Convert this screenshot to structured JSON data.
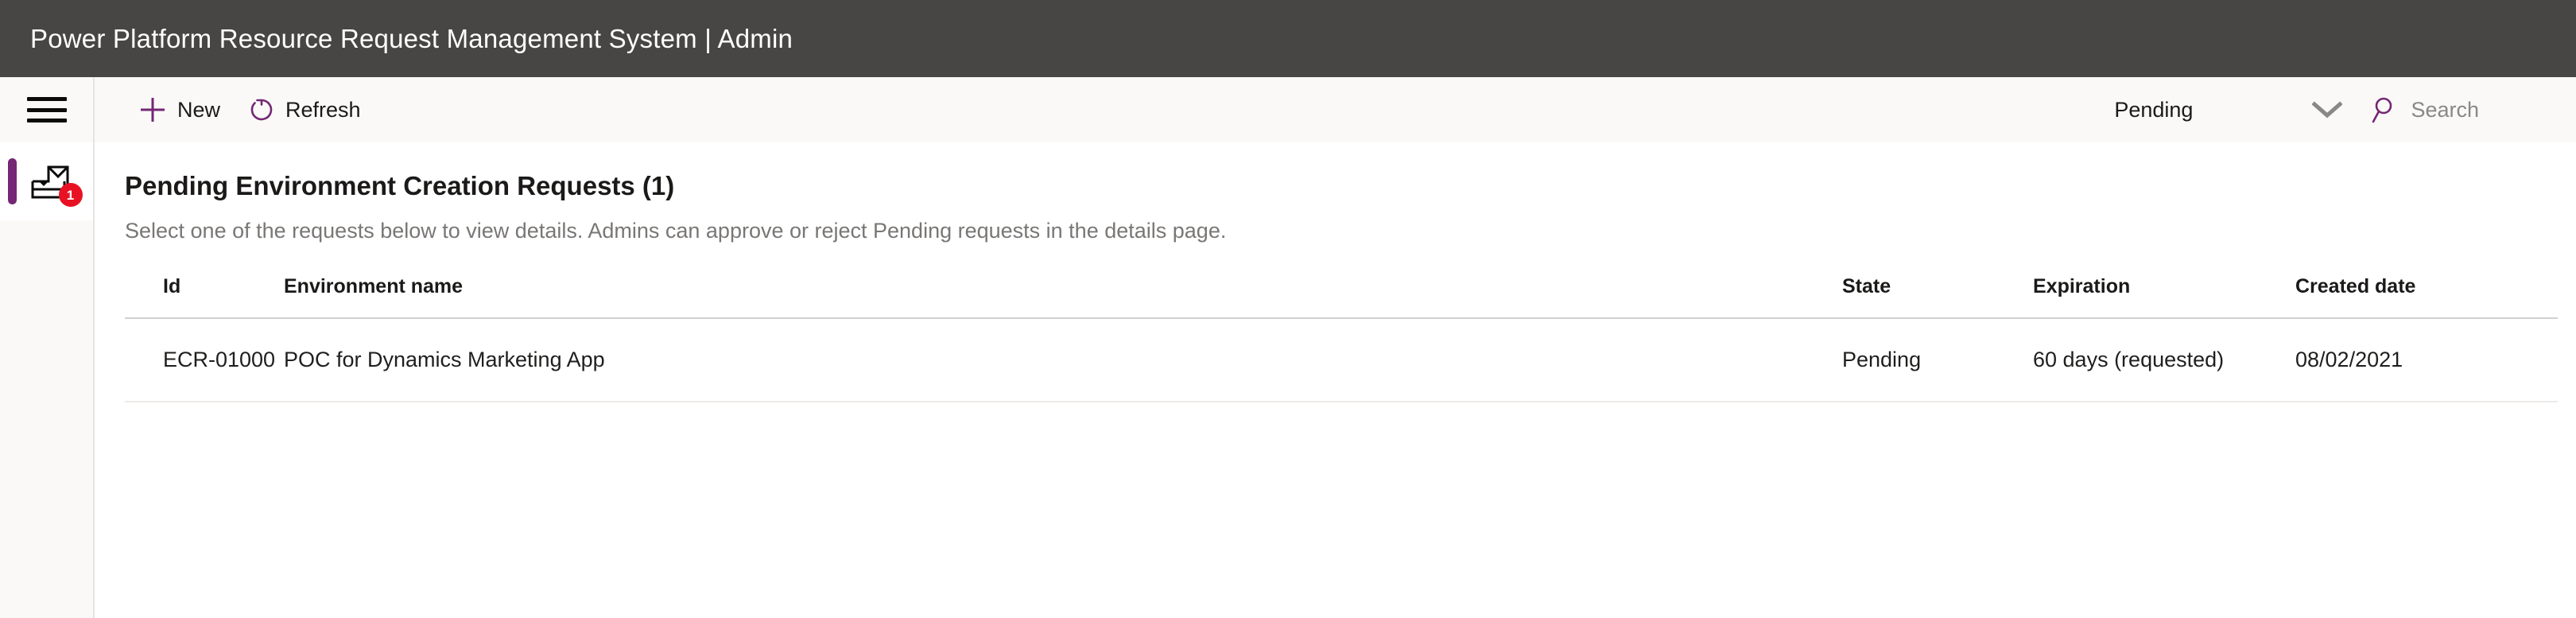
{
  "app": {
    "title": "Power Platform Resource Request Management System | Admin",
    "header_bg": "#484644",
    "accent": "#742774",
    "badge_color": "#e81123"
  },
  "rail": {
    "hamburger_icon": "hamburger-menu-icon",
    "items": [
      {
        "icon": "inbox-tray-icon",
        "badge": "1",
        "active": true
      }
    ]
  },
  "command_bar": {
    "new_label": "New",
    "new_icon": "plus-icon",
    "refresh_label": "Refresh",
    "refresh_icon": "refresh-circular-arrow-icon",
    "filter": {
      "selected": "Pending",
      "chevron_icon": "chevron-down-icon",
      "options": [
        "Pending"
      ]
    },
    "search": {
      "icon": "search-magnifier-icon",
      "placeholder": "Search",
      "value": ""
    }
  },
  "main": {
    "page_title": "Pending Environment Creation Requests (1)",
    "page_subtitle": "Select one of the requests below to view details. Admins can approve or reject Pending requests in the details page."
  },
  "table": {
    "columns": [
      {
        "key": "id",
        "label": "Id"
      },
      {
        "key": "environment_name",
        "label": "Environment name"
      },
      {
        "key": "state",
        "label": "State"
      },
      {
        "key": "expiration",
        "label": "Expiration"
      },
      {
        "key": "created_date",
        "label": "Created date"
      }
    ],
    "rows": [
      {
        "id": "ECR-01000",
        "environment_name": "POC for Dynamics Marketing App",
        "state": "Pending",
        "expiration": "60 days (requested)",
        "created_date": "08/02/2021"
      }
    ]
  }
}
